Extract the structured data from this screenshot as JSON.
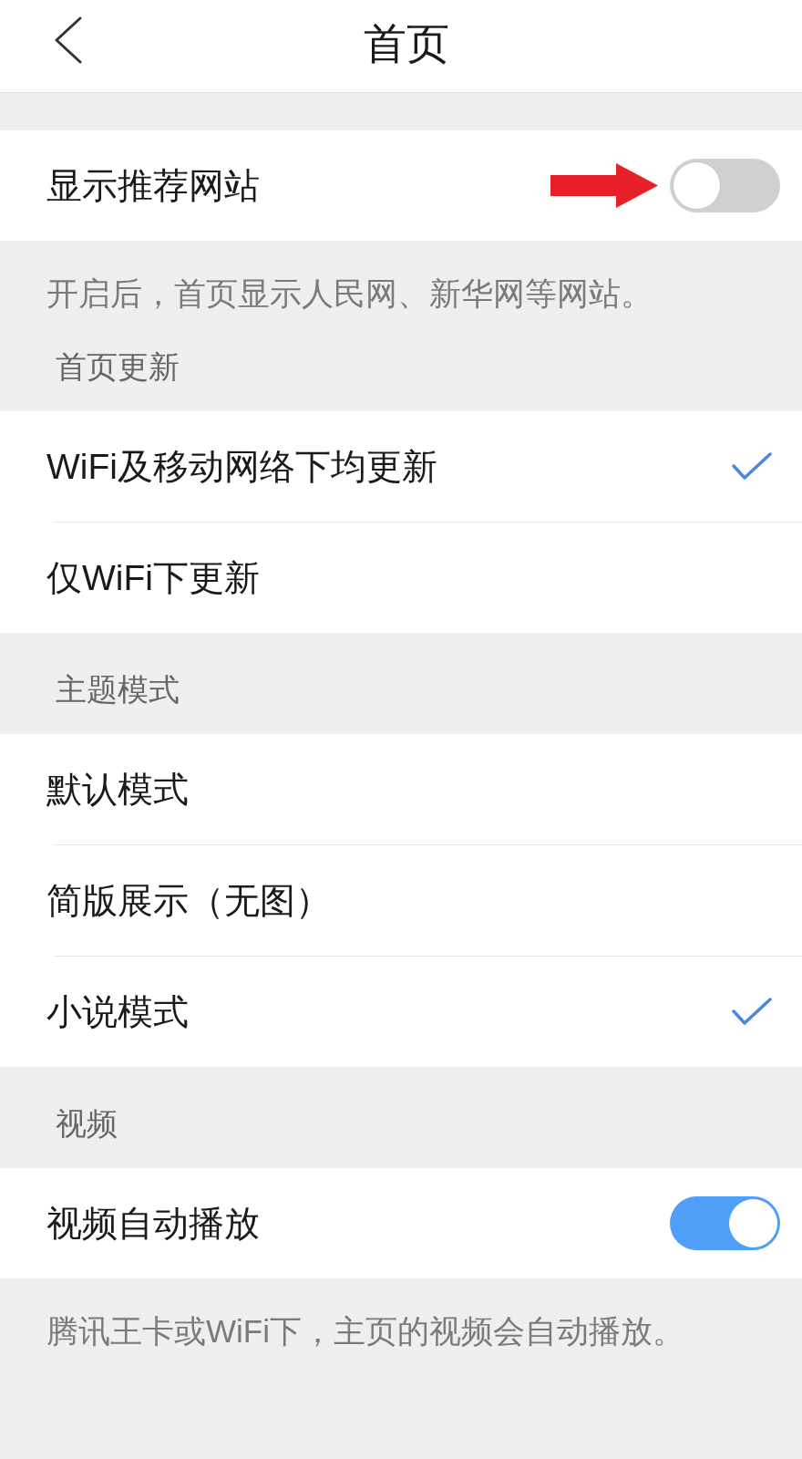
{
  "header": {
    "title": "首页"
  },
  "sections": [
    {
      "kind": "toggles",
      "rows": [
        {
          "label": "显示推荐网站",
          "on": false,
          "annotated": true
        }
      ],
      "note": "开启后，首页显示人民网、新华网等网站。"
    },
    {
      "kind": "choices",
      "heading": "首页更新",
      "rows": [
        {
          "label": "WiFi及移动网络下均更新",
          "selected": true
        },
        {
          "label": "仅WiFi下更新",
          "selected": false
        }
      ]
    },
    {
      "kind": "choices",
      "heading": "主题模式",
      "rows": [
        {
          "label": "默认模式",
          "selected": false
        },
        {
          "label": "简版展示（无图）",
          "selected": false
        },
        {
          "label": "小说模式",
          "selected": true
        }
      ]
    },
    {
      "kind": "toggles",
      "heading": "视频",
      "rows": [
        {
          "label": "视频自动播放",
          "on": true,
          "annotated": false
        }
      ],
      "note": "腾讯王卡或WiFi下，主页的视频会自动播放。"
    }
  ]
}
